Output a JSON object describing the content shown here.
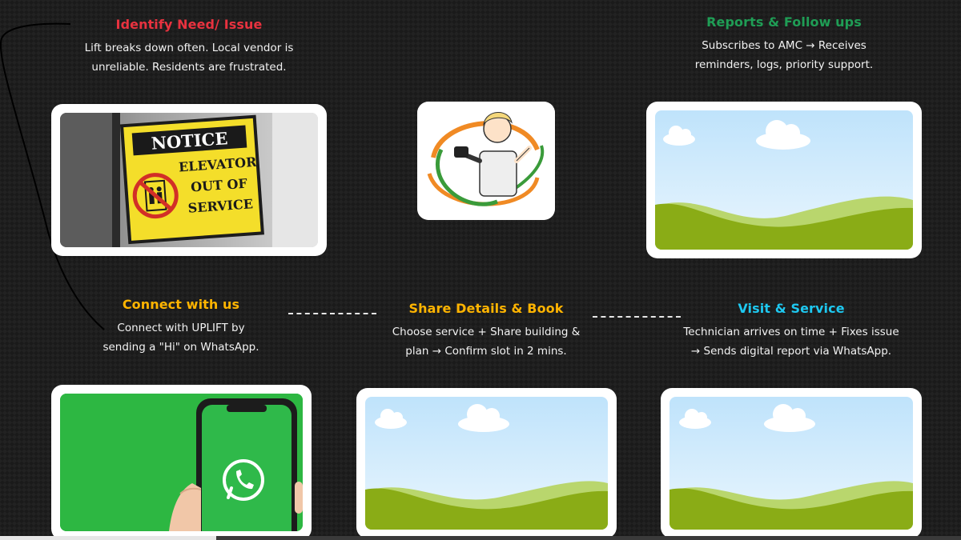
{
  "colors": {
    "title_red": "#e8323f",
    "title_green": "#1f9d55",
    "title_orange": "#ffb400",
    "title_cyan": "#1ec8f0",
    "whatsapp_green": "#2db742"
  },
  "steps": {
    "identify": {
      "title": "Identify Need/ Issue",
      "desc_line1": "Lift breaks down often. Local vendor is",
      "desc_line2": "unreliable. Residents are frustrated."
    },
    "reports": {
      "title": "Reports & Follow ups",
      "desc_line1": "Subscribes to AMC → Receives",
      "desc_line2": "reminders, logs, priority support."
    },
    "connect": {
      "title": "Connect with us",
      "desc_line1": "Connect with UPLIFT by",
      "desc_line2": "sending a \"Hi\" on WhatsApp."
    },
    "share": {
      "title": "Share Details & Book",
      "desc_line1": "Choose service + Share building &",
      "desc_line2": "plan → Confirm slot in 2 mins."
    },
    "visit": {
      "title": "Visit & Service",
      "desc_line1": "Technician arrives on time + Fixes issue",
      "desc_line2": "→ Sends digital report via WhatsApp."
    }
  },
  "notice_sign": {
    "heading": "NOTICE",
    "line1": "ELEVATOR",
    "line2": "OUT OF",
    "line3": "SERVICE"
  },
  "icons": {
    "connector": "curved-line",
    "whatsapp": "whatsapp-icon",
    "placeholder": "landscape-placeholder-icon"
  }
}
